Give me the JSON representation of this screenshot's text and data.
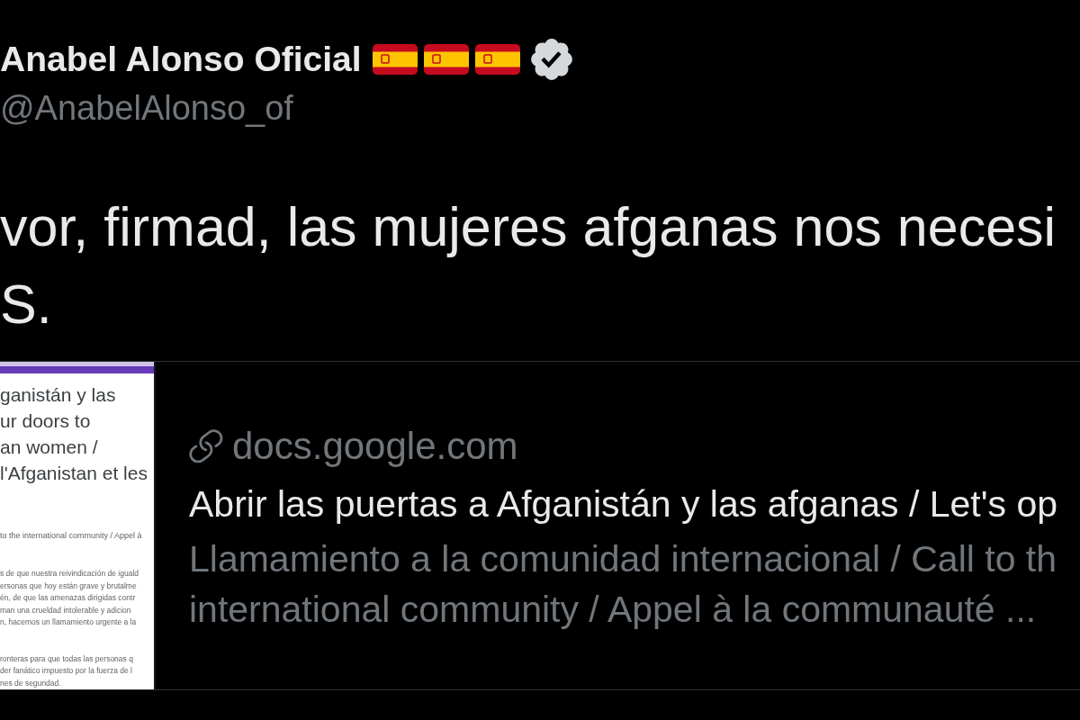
{
  "tweet": {
    "author": {
      "name": "Anabel Alonso Oficial",
      "verified": true,
      "handle": "@AnabelAlonso_of"
    },
    "text": "vor, firmad, las mujeres afganas nos necesi\nS.",
    "link_card": {
      "thumbnail": {
        "title": "ganistán y las\nur doors to\nan women /\nl'Afganistan et les",
        "subtitle": "to the international community / Appel à",
        "paragraphs": [
          "s de que nuestra reivindicación de iguald\nersonas que hoy están grave y brutalme\nén, de que las amenazas dirigidas contr\nman una crueldad intolerable y adicion\nn, hacemos un llamamiento urgente a la",
          "ronteras para que todas las personas q\nder fanático impuesto por la fuerza de l\nnes de seguridad."
        ]
      },
      "domain": "docs.google.com",
      "title": "Abrir las puertas a Afganistán y las afganas / Let's op",
      "description": "Llamamiento a la comunidad internacional / Call to th\ninternational community / Appel à la communauté ..."
    }
  }
}
